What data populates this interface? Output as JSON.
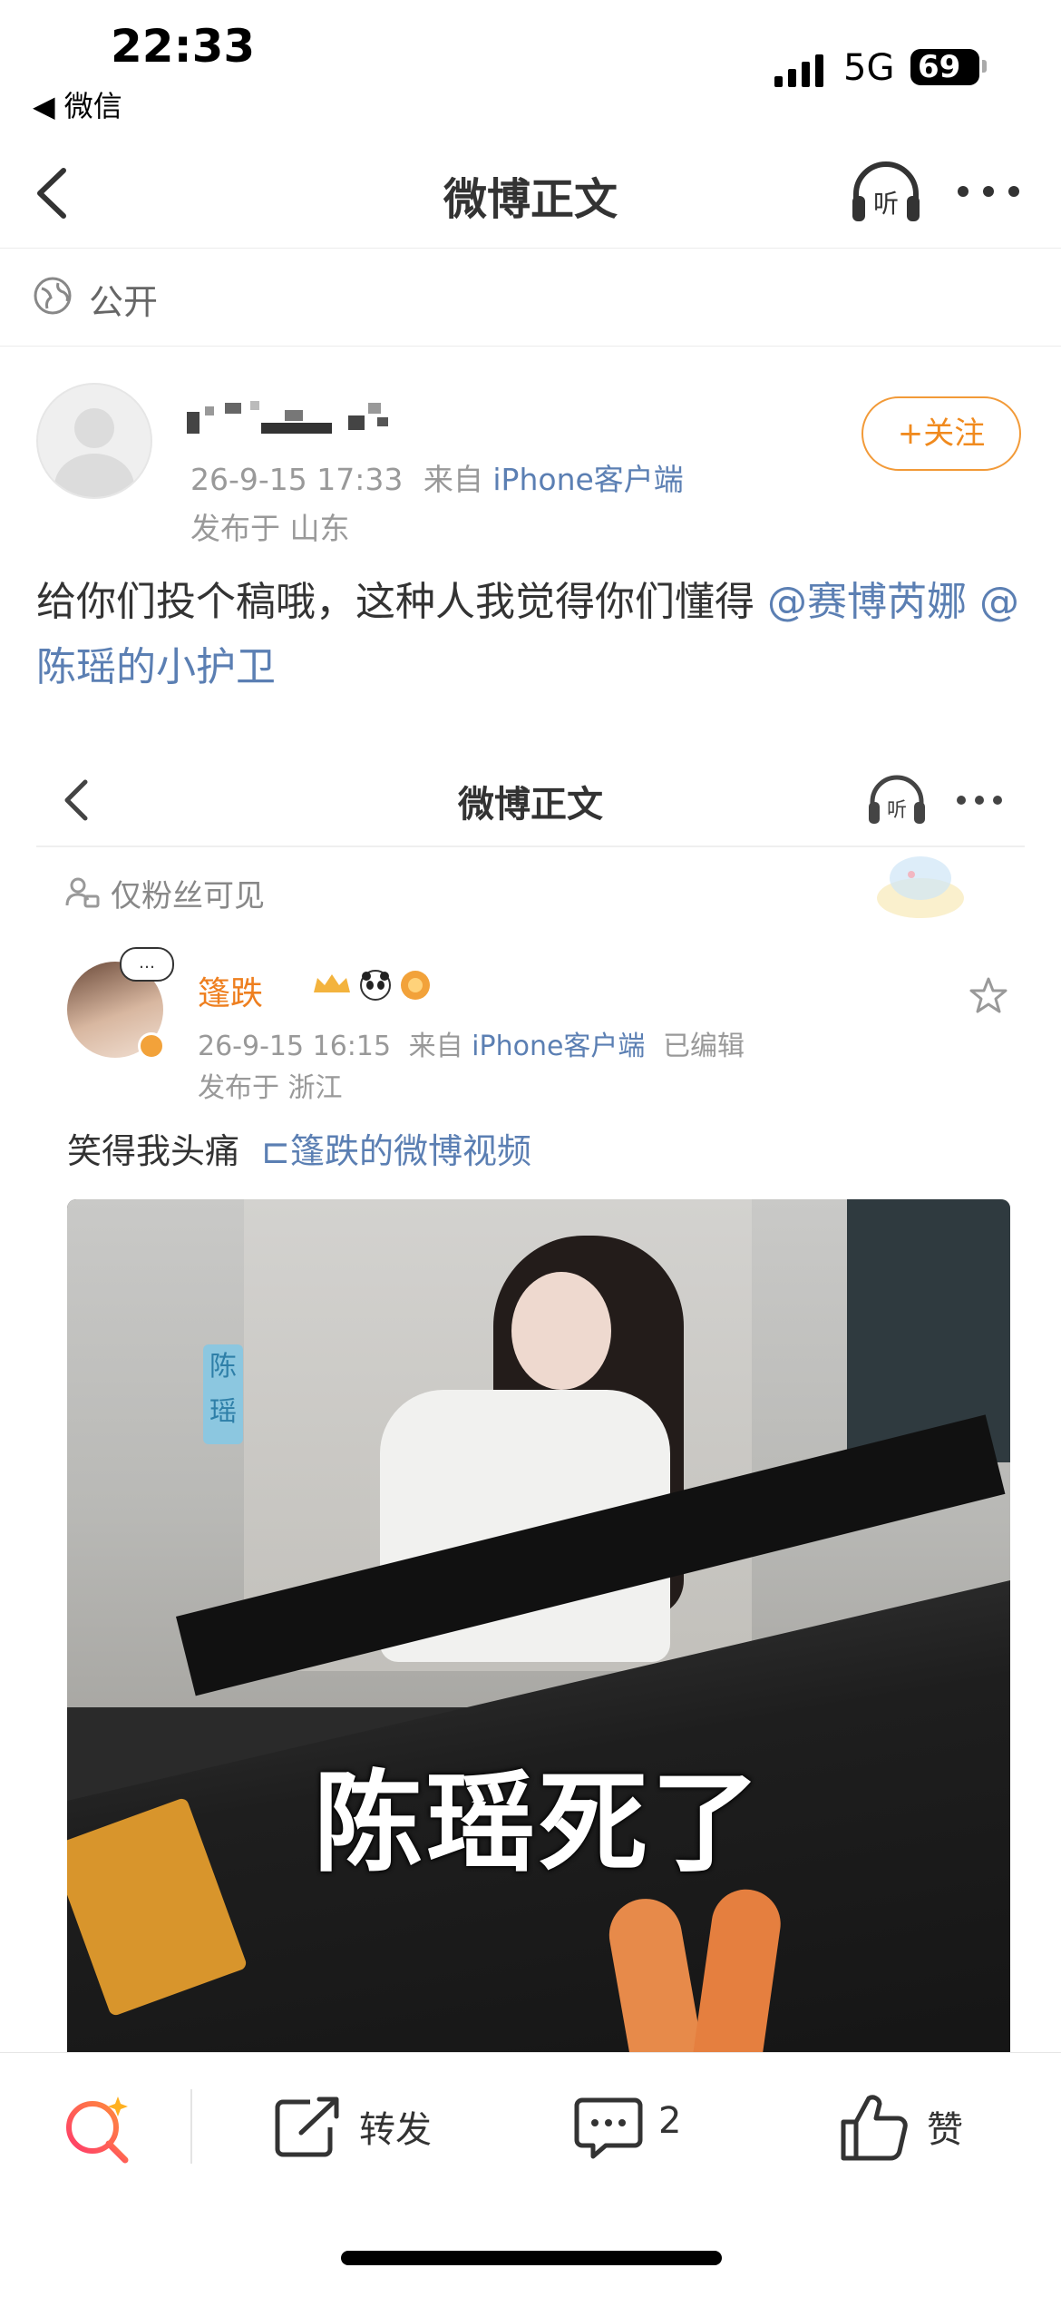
{
  "status_bar": {
    "time": "22:33",
    "back_app": "◀ 微信",
    "network": "5G",
    "battery": "69"
  },
  "nav": {
    "title": "微博正文"
  },
  "visibility": {
    "label": "公开"
  },
  "post": {
    "author": {
      "timestamp": "26-9-15 17:33",
      "source_prefix": "来自",
      "client": "iPhone客户端",
      "location": "发布于 山东",
      "follow_label": "+关注"
    },
    "text": "给你们投个稿哦，这种人我觉得你们懂得",
    "mentions": [
      "@赛博芮娜",
      "@陈瑶的小护卫"
    ]
  },
  "embedded": {
    "nav_title": "微博正文",
    "visibility_label": "仅粉丝可见",
    "avatar_bubble": "…",
    "author_name": "篷跌",
    "timestamp": "26-9-15 16:15",
    "source_prefix": "来自",
    "client": "iPhone客户端",
    "edited": "已编辑",
    "location": "发布于 浙江",
    "text": "笑得我头痛",
    "video_link": "篷跌的微博视频",
    "video_tag": "陈瑶",
    "video_caption": "陈瑶死了"
  },
  "bottom_bar": {
    "repost_label": "转发",
    "comment_count": "2",
    "like_label": "赞"
  },
  "colors": {
    "accent_orange": "#f08a1e",
    "link_blue": "#5b7fb3",
    "search_gradient": [
      "#ff3b6b",
      "#ffb020"
    ]
  }
}
